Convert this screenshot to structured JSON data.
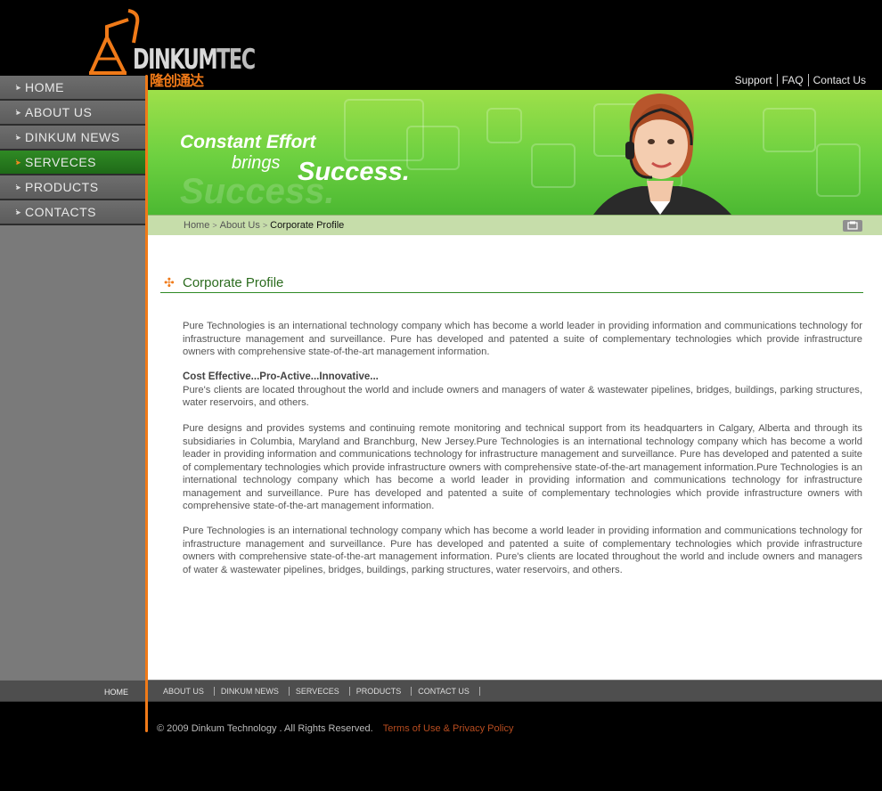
{
  "header": {
    "logo_text": "DINKUM",
    "logo_text_tec": "TEC",
    "logo_cn": "隆创通达",
    "toplinks": [
      "Support",
      "FAQ",
      "Contact Us"
    ]
  },
  "sidebar": {
    "items": [
      {
        "label": "HOME",
        "active": false
      },
      {
        "label": "ABOUT US",
        "active": false
      },
      {
        "label": "DINKUM NEWS",
        "active": false
      },
      {
        "label": "SERVECES",
        "active": true
      },
      {
        "label": "PRODUCTS",
        "active": false
      },
      {
        "label": "CONTACTS",
        "active": false
      }
    ]
  },
  "banner": {
    "line1": "Constant Effort",
    "line2": "brings",
    "line3": "Success.",
    "ghost": "Success.",
    "colors": {
      "top": "#9ee04a",
      "bottom": "#4cb832"
    }
  },
  "breadcrumb": {
    "home": "Home",
    "about": "About Us",
    "current": "Corporate Profile",
    "print_icon": "print-icon"
  },
  "content": {
    "section_title": "Corporate Profile",
    "paragraph1": "Pure Technologies is an international technology company which has become a world leader in providing information and communications technology for infrastructure management and surveillance. Pure has developed and patented a suite of complementary technologies which provide infrastructure owners with comprehensive state-of-the-art management information.",
    "subheading": "Cost Effective...Pro-Active...Innovative...",
    "paragraph2": "Pure's clients are located throughout the world and include owners and managers of water & wastewater pipelines, bridges, buildings, parking structures, water reservoirs, and others.",
    "paragraph3": "Pure designs and provides systems and continuing remote monitoring and technical support from its headquarters in Calgary, Alberta and through its subsidiaries in Columbia, Maryland and Branchburg, New Jersey.Pure Technologies is an international technology company which has become a world leader in providing information and communications technology for infrastructure management and surveillance. Pure has developed and patented a suite of complementary technologies which provide infrastructure owners with comprehensive state-of-the-art management information.Pure Technologies is an international technology company which has become a world leader in providing information and communications technology for infrastructure management and surveillance. Pure has developed and patented a suite of complementary technologies which provide infrastructure owners with comprehensive state-of-the-art management information.",
    "paragraph4": "Pure Technologies is an international technology company which has become a world leader in providing information and communications technology for infrastructure management and surveillance. Pure has developed and patented a suite of complementary technologies which provide infrastructure owners with comprehensive state-of-the-art management information. Pure's clients are located throughout the world and include owners and managers of water & wastewater pipelines, bridges, buildings, parking structures, water reservoirs, and others."
  },
  "footer": {
    "home": "HOME",
    "links": [
      "ABOUT US",
      "DINKUM NEWS",
      "SERVECES",
      "PRODUCTS",
      "CONTACT US"
    ],
    "copyright": "© 2009 Dinkum Technology . All Rights Reserved.",
    "terms": "Terms of Use & Privacy Policy"
  },
  "colors": {
    "accent_orange": "#f07a18",
    "accent_green": "#2f8a24"
  }
}
